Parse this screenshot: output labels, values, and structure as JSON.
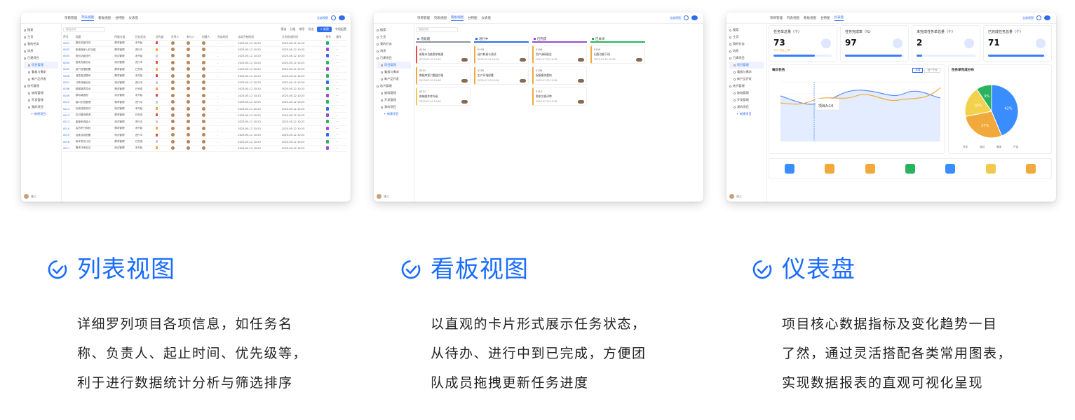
{
  "screens": {
    "list": {
      "tabs": [
        "项目管理",
        "列表视图",
        "看板视图",
        "甘特图",
        "仪表盘"
      ],
      "active_tab": "列表视图",
      "top_right": "全部视图",
      "search_placeholder": "搜索任务",
      "tools": [
        "筛选",
        "分组",
        "排序",
        "导出",
        "+ 新建",
        "字段配置"
      ],
      "columns": [
        "序号",
        "标题",
        "所属分组",
        "任务状态",
        "优先级",
        "负责人",
        "参与人",
        "创建人",
        "完成时间",
        "实际开始时间",
        "计划完成时间",
        "附件",
        "操作"
      ],
      "rows": [
        {
          "id": "0001",
          "title": "整改总部任务",
          "group": "需求管理",
          "status": "未开始",
          "flag": "r",
          "date1": "2023-05-12 10:23",
          "date2": "2023-05-12 10:23",
          "doc": "g"
        },
        {
          "id": "0002",
          "title": "新增商家入驻功能",
          "group": "需求管理",
          "status": "进行中",
          "flag": "y",
          "date1": "2023-05-12 10:23",
          "date2": "2023-05-12 10:23",
          "doc": "p"
        },
        {
          "id": "0003",
          "title": "首页功能迭代",
          "group": "测试管理",
          "status": "未开始",
          "flag": "g",
          "date1": "2023-05-12 10:23",
          "date2": "2023-05-12 10:23",
          "doc": "b"
        },
        {
          "id": "0004",
          "title": "登录页面优化",
          "group": "测试管理",
          "status": "进行中",
          "flag": "r",
          "date1": "2023-05-12 10:23",
          "date2": "2023-05-12 10:23",
          "doc": "g"
        },
        {
          "id": "0005",
          "title": "用户权限配置",
          "group": "需求管理",
          "status": "已完成",
          "flag": "y",
          "date1": "2023-05-12 10:23",
          "date2": "2023-05-12 10:23",
          "doc": "p"
        },
        {
          "id": "0006",
          "title": "消息推送模块",
          "group": "需求管理",
          "status": "未开始",
          "flag": "r",
          "date1": "2023-05-12 10:23",
          "date2": "2023-05-12 10:23",
          "doc": "g"
        },
        {
          "id": "0007",
          "title": "订单流程优化",
          "group": "测试管理",
          "status": "进行中",
          "flag": "g",
          "date1": "2023-05-12 10:23",
          "date2": "2023-05-12 10:23",
          "doc": "b"
        },
        {
          "id": "0008",
          "title": "数据报表导出",
          "group": "需求管理",
          "status": "已完成",
          "flag": "y",
          "date1": "2023-05-12 10:23",
          "date2": "2023-05-12 10:23",
          "doc": "g"
        },
        {
          "id": "0009",
          "title": "移动端适配",
          "group": "测试管理",
          "status": "未开始",
          "flag": "r",
          "date1": "2023-05-12 10:23",
          "date2": "2023-05-12 10:23",
          "doc": "p"
        },
        {
          "id": "0010",
          "title": "接口文档整理",
          "group": "需求管理",
          "status": "进行中",
          "flag": "g",
          "date1": "2023-05-12 10:23",
          "date2": "2023-05-12 10:23",
          "doc": "g"
        },
        {
          "id": "0011",
          "title": "系统性能测试",
          "group": "测试管理",
          "status": "未开始",
          "flag": "y",
          "date1": "2023-05-12 10:23",
          "date2": "2023-05-12 10:23",
          "doc": "b"
        },
        {
          "id": "0012",
          "title": "支付模块联调",
          "group": "需求管理",
          "status": "已完成",
          "flag": "r",
          "date1": "2023-05-12 10:23",
          "date2": "2023-05-12 10:23",
          "doc": "p"
        },
        {
          "id": "0013",
          "title": "客服系统接入",
          "group": "测试管理",
          "status": "进行中",
          "flag": "g",
          "date1": "2023-05-12 10:23",
          "date2": "2023-05-12 10:23",
          "doc": "g"
        },
        {
          "id": "0014",
          "title": "会员积分规则",
          "group": "需求管理",
          "status": "未开始",
          "flag": "y",
          "date1": "2023-05-12 10:23",
          "date2": "2023-05-12 10:23",
          "doc": "p"
        },
        {
          "id": "0015",
          "title": "运营活动配置",
          "group": "测试管理",
          "status": "进行中",
          "flag": "r",
          "date1": "2023-05-12 10:23",
          "date2": "2023-05-12 10:23",
          "doc": "b"
        },
        {
          "id": "0016",
          "title": "版本发布计划",
          "group": "需求管理",
          "status": "已完成",
          "flag": "g",
          "date1": "2023-05-12 10:23",
          "date2": "2023-05-12 10:23",
          "doc": "g"
        },
        {
          "id": "0017",
          "title": "需求评审会议",
          "group": "测试管理",
          "status": "未开始",
          "flag": "y",
          "date1": "2023-05-12 10:23",
          "date2": "2023-05-12 10:23",
          "doc": "p"
        }
      ]
    },
    "kanban": {
      "active_tab": "看板视图",
      "columns": [
        {
          "name": "待处理",
          "color": "#8a94a6",
          "cards": [
            {
              "no": "0104",
              "title": "新版本功能需求梳理",
              "date": "2023-07-20 10:56",
              "color": "#e84a4a"
            },
            {
              "no": "0101",
              "title": "数据库索引重建方案",
              "date": "2023-07-20 10:56",
              "color": "#f2a93b"
            },
            {
              "no": "0111",
              "title": "前端组件库升级",
              "date": "2023-07-20 10:56",
              "color": "#f2c94c"
            }
          ]
        },
        {
          "name": "进行中",
          "color": "#2d6bf0",
          "cards": [
            {
              "no": "0103",
              "title": "接口联调与测试",
              "date": "2023-07-20 10:56",
              "color": "#f2a93b"
            },
            {
              "no": "0105",
              "title": "生产环境部署",
              "date": "2023-07-20 10:56",
              "color": "#f2a93b"
            }
          ]
        },
        {
          "name": "已完成",
          "color": "#9b4ad8",
          "cards": [
            {
              "no": "0108",
              "title": "用户调研报告",
              "date": "2023-07-20 10:56",
              "color": "#f2a93b"
            },
            {
              "no": "0106",
              "title": "权限模块重构",
              "date": "2023-07-20 10:56",
              "color": "#f2a93b"
            },
            {
              "no": "0110",
              "title": "需求文档评审",
              "date": "2023-07-20 10:56",
              "color": "#f2a93b"
            }
          ]
        },
        {
          "name": "已关闭",
          "color": "#29b35f",
          "cards": [
            {
              "no": "0109",
              "title": "旧版功能下线",
              "date": "2023-07-20 10:56",
              "color": "#f2a93b"
            }
          ]
        }
      ]
    },
    "dashboard": {
      "active_tab": "仪表盘",
      "kpis": [
        {
          "label": "任务单总量（个）",
          "value": "73",
          "note": "10% 同比上周",
          "fill": 0.7
        },
        {
          "label": "任务完成率（%）",
          "value": "97",
          "note": "",
          "fill": 0.97
        },
        {
          "label": "未完成任务单总量（个）",
          "value": "2",
          "note": "",
          "fill": 0.1
        },
        {
          "label": "已完成任务总量（个）",
          "value": "71",
          "note": "",
          "fill": 0.95
        }
      ],
      "line_title": "每日任务",
      "line_tabs": [
        "本周",
        "近一个月"
      ],
      "tooltip": "项目A:16",
      "pie_title": "任务单完成分布",
      "pie": [
        {
          "label": "42%",
          "value": 42,
          "color": "#3a8dff"
        },
        {
          "label": "27%",
          "value": 27,
          "color": "#f2a93b"
        },
        {
          "label": "18%",
          "value": 18,
          "color": "#f2d24c"
        },
        {
          "label": "9%",
          "value": 9,
          "color": "#29b35f"
        }
      ],
      "pie_legend": [
        "开发",
        "测试",
        "需求",
        "产品"
      ],
      "line_legend": [
        "项目A",
        "项目B"
      ],
      "app_colors": [
        "#3a8dff",
        "#f2a93b",
        "#f2a93b",
        "#29b35f",
        "#3a8dff",
        "#f2c94c",
        "#f2a93b"
      ]
    },
    "sidebar": [
      "搜索",
      "主页",
      "我的任务",
      "消息",
      "已建项目",
      "项目管理",
      "看板与需求",
      "新产品开发",
      "迭代管理",
      "缺陷管理",
      "开发管理",
      "我的项目",
      "+ 新建项目"
    ],
    "sidebar_user": "张三"
  },
  "features": [
    {
      "title": "列表视图",
      "lines": [
        "详细罗列项目各项信息，如任务名",
        "称、负责人、起止时间、优先级等，",
        "利于进行数据统计分析与筛选排序"
      ]
    },
    {
      "title": "看板视图",
      "lines": [
        "以直观的卡片形式展示任务状态，",
        "从待办、进行中到已完成，方便团",
        "队成员拖拽更新任务进度"
      ]
    },
    {
      "title": "仪表盘",
      "lines": [
        "项目核心数据指标及变化趋势一目",
        "了然，通过灵活搭配各类常用图表，",
        "实现数据报表的直观可视化呈现"
      ]
    }
  ],
  "accent": "#1a6cff"
}
